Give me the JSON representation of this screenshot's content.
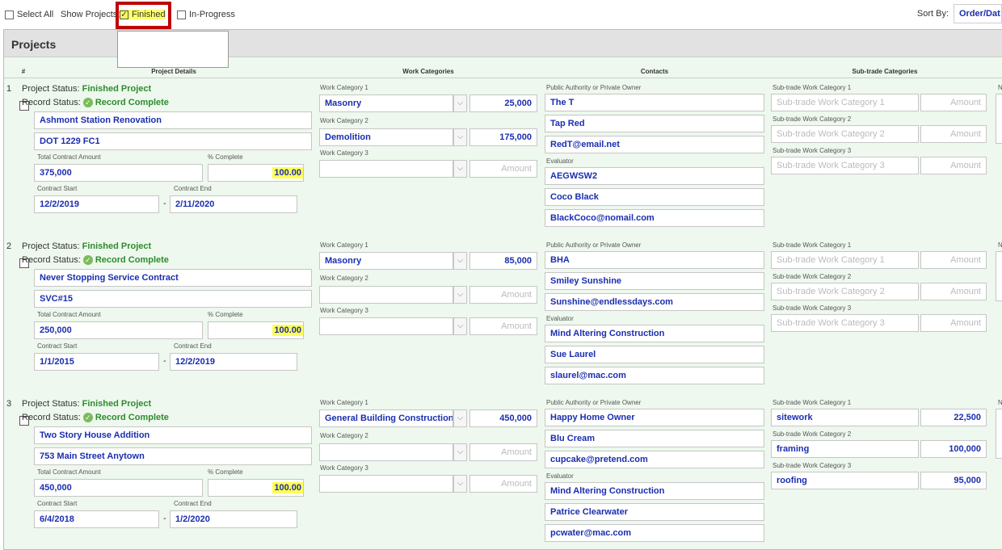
{
  "toolbar": {
    "select_all": "Select All",
    "show_projects": "Show Projects:",
    "finished": "Finished",
    "in_progress": "In-Progress",
    "sort_by": "Sort By:",
    "sort_value": "Order/Dat"
  },
  "panel_title": "Projects",
  "columns": {
    "num": "#",
    "details": "Project Details",
    "work": "Work Categories",
    "contacts": "Contacts",
    "subtrade": "Sub-trade Categories",
    "notes": "N"
  },
  "labels": {
    "project_status": "Project Status:",
    "record_status": "Record Status:",
    "total_contract": "Total Contract Amount",
    "pct_complete": "% Complete",
    "contract_start": "Contract Start",
    "contract_end": "Contract End",
    "work_cat_1": "Work Category 1",
    "work_cat_2": "Work Category 2",
    "work_cat_3": "Work Category 3",
    "public_authority": "Public Authority or Private Owner",
    "evaluator": "Evaluator",
    "sub_cat_1": "Sub-trade Work Category 1",
    "sub_cat_2": "Sub-trade Work Category 2",
    "sub_cat_3": "Sub-trade Work Category 3",
    "dash": "-",
    "amount_placeholder": "Amount"
  },
  "projects": [
    {
      "num": "1",
      "project_status": "Finished Project",
      "record_status": "Record Complete",
      "name": "Ashmont Station Renovation",
      "code": "DOT 1229 FC1",
      "total": "375,000",
      "pct": "100.00",
      "start": "12/2/2019",
      "end": "2/11/2020",
      "work": [
        {
          "cat": "Masonry",
          "amount": "25,000"
        },
        {
          "cat": "Demolition",
          "amount": "175,000"
        },
        {
          "cat": "",
          "amount": ""
        }
      ],
      "contacts": [
        "The T",
        "Tap Red",
        "RedT@email.net"
      ],
      "evaluator": [
        "AEGWSW2",
        "Coco Black",
        "BlackCoco@nomail.com"
      ],
      "sub": [
        {
          "cat": "",
          "amount": "",
          "cat_ph": "Sub-trade Work Category 1"
        },
        {
          "cat": "",
          "amount": "",
          "cat_ph": "Sub-trade Work Category 2"
        },
        {
          "cat": "",
          "amount": "",
          "cat_ph": "Sub-trade Work Category 3"
        }
      ]
    },
    {
      "num": "2",
      "project_status": "Finished Project",
      "record_status": "Record Complete",
      "name": "Never Stopping Service Contract",
      "code": "SVC#15",
      "total": "250,000",
      "pct": "100.00",
      "start": "1/1/2015",
      "end": "12/2/2019",
      "work": [
        {
          "cat": "Masonry",
          "amount": "85,000"
        },
        {
          "cat": "",
          "amount": ""
        },
        {
          "cat": "",
          "amount": ""
        }
      ],
      "contacts": [
        "BHA",
        "Smiley Sunshine",
        "Sunshine@endlessdays.com"
      ],
      "evaluator": [
        "Mind Altering Construction",
        "Sue Laurel",
        "slaurel@mac.com"
      ],
      "sub": [
        {
          "cat": "",
          "amount": "",
          "cat_ph": "Sub-trade Work Category 1"
        },
        {
          "cat": "",
          "amount": "",
          "cat_ph": "Sub-trade Work Category 2"
        },
        {
          "cat": "",
          "amount": "",
          "cat_ph": "Sub-trade Work Category 3"
        }
      ]
    },
    {
      "num": "3",
      "project_status": "Finished Project",
      "record_status": "Record Complete",
      "name": "Two Story House Addition",
      "code": "753 Main Street Anytown",
      "total": "450,000",
      "pct": "100.00",
      "start": "6/4/2018",
      "end": "1/2/2020",
      "work": [
        {
          "cat": "General Building Construction",
          "amount": "450,000"
        },
        {
          "cat": "",
          "amount": ""
        },
        {
          "cat": "",
          "amount": ""
        }
      ],
      "contacts": [
        "Happy Home Owner",
        "Blu Cream",
        "cupcake@pretend.com"
      ],
      "evaluator": [
        "Mind Altering Construction",
        "Patrice Clearwater",
        "pcwater@mac.com"
      ],
      "sub": [
        {
          "cat": "sitework",
          "amount": "22,500",
          "cat_ph": "Sub-trade Work Category 1"
        },
        {
          "cat": "framing",
          "amount": "100,000",
          "cat_ph": "Sub-trade Work Category 2"
        },
        {
          "cat": "roofing",
          "amount": "95,000",
          "cat_ph": "Sub-trade Work Category 3"
        }
      ]
    }
  ]
}
